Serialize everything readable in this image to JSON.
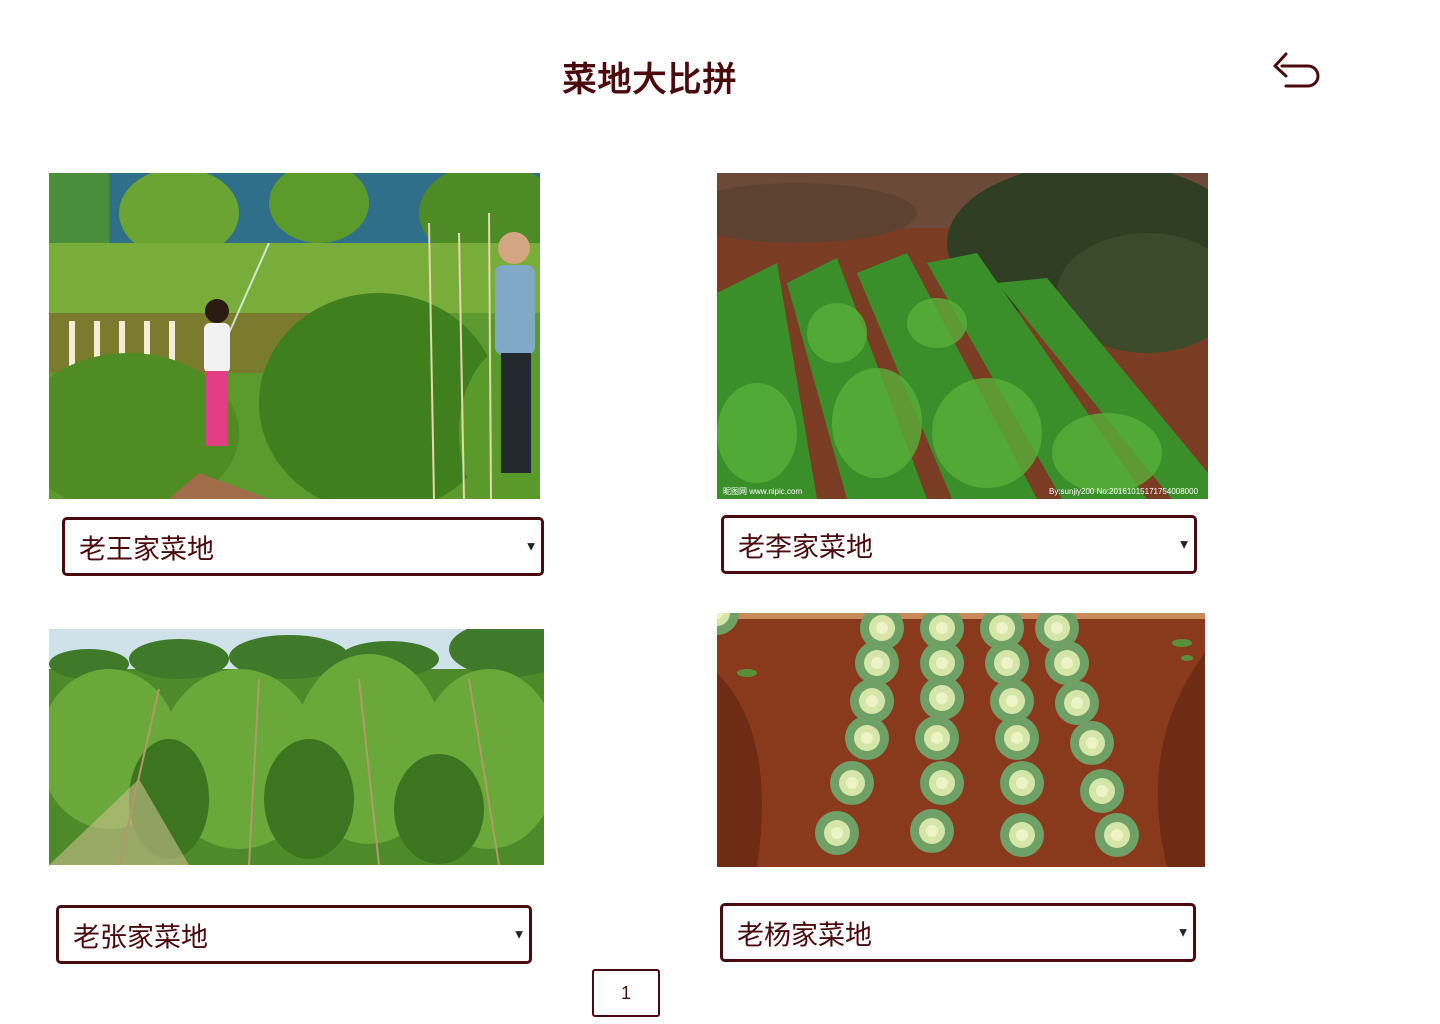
{
  "page": {
    "title": "菜地大比拼"
  },
  "header": {
    "back_icon": "undo-arrow-icon"
  },
  "gardens": [
    {
      "photo": "garden-wang-photo",
      "label": "老王家菜地"
    },
    {
      "photo": "garden-li-photo",
      "label": "老李家菜地",
      "watermark_left": "昵图网 www.nipic.com",
      "watermark_right": "By:sunjiy200 No:20161015171754008000"
    },
    {
      "photo": "garden-zhang-photo",
      "label": "老张家菜地"
    },
    {
      "photo": "garden-yang-photo",
      "label": "老杨家菜地"
    }
  ],
  "pagination": {
    "current_page": "1"
  },
  "colors": {
    "accent": "#4a0a0e",
    "background": "#ffffff"
  }
}
